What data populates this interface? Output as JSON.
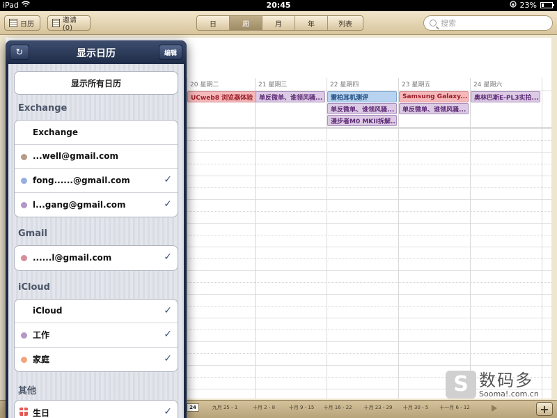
{
  "status_bar": {
    "device": "iPad",
    "time": "20:45",
    "battery_text": "23%",
    "battery_level": 0.23
  },
  "toolbar": {
    "calendars_label": "日历",
    "invitations_label": "邀请 (0)",
    "view_tabs": [
      {
        "label": "日",
        "active": false
      },
      {
        "label": "周",
        "active": true
      },
      {
        "label": "月",
        "active": false
      },
      {
        "label": "年",
        "active": false
      },
      {
        "label": "列表",
        "active": false
      }
    ],
    "search_placeholder": "搜索"
  },
  "week": {
    "days": [
      {
        "label": "20 星期二"
      },
      {
        "label": "21 星期三"
      },
      {
        "label": "22 星期四"
      },
      {
        "label": "23 星期五"
      },
      {
        "label": "24 星期六"
      }
    ],
    "all_day_events": [
      {
        "day": 0,
        "row": 0,
        "title": "UCweb8 浏览器体验",
        "color": "red"
      },
      {
        "day": 1,
        "row": 0,
        "title": "单反微单、谁领风骚...",
        "color": "purple"
      },
      {
        "day": 2,
        "row": 0,
        "title": "雷柏耳机测评",
        "color": "blue"
      },
      {
        "day": 2,
        "row": 1,
        "title": "单反微单、谁领风骚...",
        "color": "purple"
      },
      {
        "day": 2,
        "row": 2,
        "title": "漫步者M0 MKII拆解...",
        "color": "purple"
      },
      {
        "day": 3,
        "row": 0,
        "title": "Samsung Galaxy...",
        "color": "red"
      },
      {
        "day": 3,
        "row": 1,
        "title": "单反微单、谁领风骚...",
        "color": "purple"
      },
      {
        "day": 4,
        "row": 0,
        "title": "奥林巴斯E-PL3实拍...",
        "color": "purple"
      }
    ]
  },
  "timeline": {
    "current": "24",
    "items": [
      "九月 25 - 1",
      "十月 2 - 8",
      "十月 9 - 15",
      "十月 16 - 22",
      "十月 23 - 29",
      "十月 30 - 5",
      "十一月 6 - 12"
    ]
  },
  "watermark": {
    "cn": "数码多",
    "en": "Sooma!.com.cn"
  },
  "popover": {
    "title": "显示日历",
    "edit_label": "编辑",
    "show_all_label": "显示所有日历",
    "sections": [
      {
        "title": "Exchange",
        "rows": [
          {
            "label": "Exchange",
            "dot": null,
            "checked": false
          },
          {
            "label": "...well@gmail.com",
            "dot": "#b79a88",
            "checked": false
          },
          {
            "label": "fong......@gmail.com",
            "dot": "#98aee0",
            "checked": true
          },
          {
            "label": "l...gang@gmail.com",
            "dot": "#b497c6",
            "checked": true
          }
        ]
      },
      {
        "title": "Gmail",
        "rows": [
          {
            "label": "......l@gmail.com",
            "dot": "#d58e99",
            "checked": true
          }
        ]
      },
      {
        "title": "iCloud",
        "rows": [
          {
            "label": "iCloud",
            "dot": null,
            "checked": true
          },
          {
            "label": "工作",
            "dot": "#b497c6",
            "checked": true
          },
          {
            "label": "家庭",
            "dot": "#f0a57c",
            "checked": true
          }
        ]
      },
      {
        "title": "其他",
        "rows": [
          {
            "label": "生日",
            "dot": "gift",
            "checked": true
          }
        ]
      }
    ]
  }
}
